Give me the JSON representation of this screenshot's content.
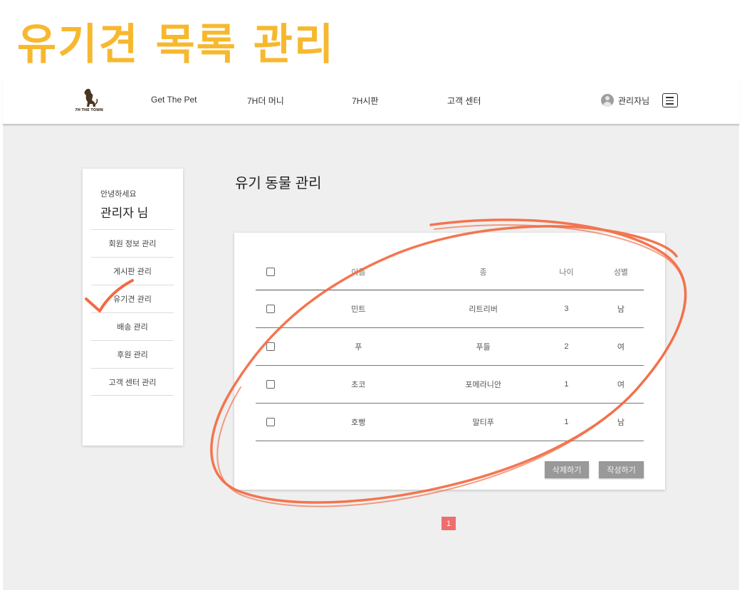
{
  "slide": {
    "title": "유기견 목록 관리"
  },
  "navbar": {
    "logo_text": "7H THE TOWN",
    "items": [
      "Get The Pet",
      "7H더 머니",
      "7H시판",
      "고객 센터"
    ],
    "user_label": "관리자님"
  },
  "sidebar": {
    "greeting": "안녕하세요",
    "name": "관리자 님",
    "items": [
      "회원 정보 관리",
      "게시판 관리",
      "유기견 관리",
      "배송 관리",
      "후원 관리",
      "고객 센터 관리"
    ]
  },
  "main": {
    "title": "유기 동물 관리",
    "table": {
      "headers": [
        "이름",
        "종",
        "나이",
        "성별"
      ],
      "rows": [
        {
          "name": "민트",
          "kind": "리트리버",
          "age": "3",
          "sex": "남"
        },
        {
          "name": "푸",
          "kind": "푸들",
          "age": "2",
          "sex": "여"
        },
        {
          "name": "초코",
          "kind": "포메라니안",
          "age": "1",
          "sex": "여"
        },
        {
          "name": "호빵",
          "kind": "말티푸",
          "age": "1",
          "sex": "남"
        }
      ]
    },
    "delete_label": "삭제하기",
    "write_label": "작성하기",
    "page": "1"
  },
  "colors": {
    "title": "#f7b82f",
    "annotation": "#f26a42",
    "pager": "#f06d6d",
    "button": "#999999"
  },
  "annotations": [
    "check-mark",
    "circle-scribble"
  ]
}
